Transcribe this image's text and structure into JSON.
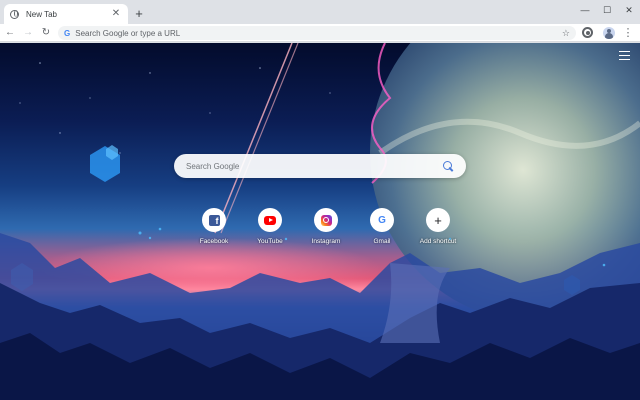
{
  "browser": {
    "tab": {
      "title": "New Tab",
      "favicon": "globe-icon",
      "close_glyph": "✕"
    },
    "new_tab_glyph": "+",
    "window_controls": {
      "minimize": "—",
      "maximize": "☐",
      "close": "✕"
    },
    "nav": {
      "back": "←",
      "forward": "→",
      "reload": "↻"
    },
    "omnibox": {
      "logo": "G",
      "placeholder": "Search Google or type a URL",
      "value": "",
      "star": "☆"
    },
    "menu": "⋮"
  },
  "page": {
    "search": {
      "placeholder": "Search Google"
    },
    "shortcuts": [
      {
        "label": "Facebook",
        "icon": "facebook-icon",
        "glyph": "f"
      },
      {
        "label": "YouTube",
        "icon": "youtube-icon"
      },
      {
        "label": "Instagram",
        "icon": "instagram-icon"
      },
      {
        "label": "Gmail",
        "icon": "google-icon",
        "glyph": "G"
      },
      {
        "label": "Add shortcut",
        "icon": "plus-icon",
        "glyph": "+"
      }
    ]
  },
  "colors": {
    "accent": "#4285f4",
    "facebook": "#3b5998",
    "youtube": "#ff0000",
    "chrome_frame": "#dee1e6"
  }
}
